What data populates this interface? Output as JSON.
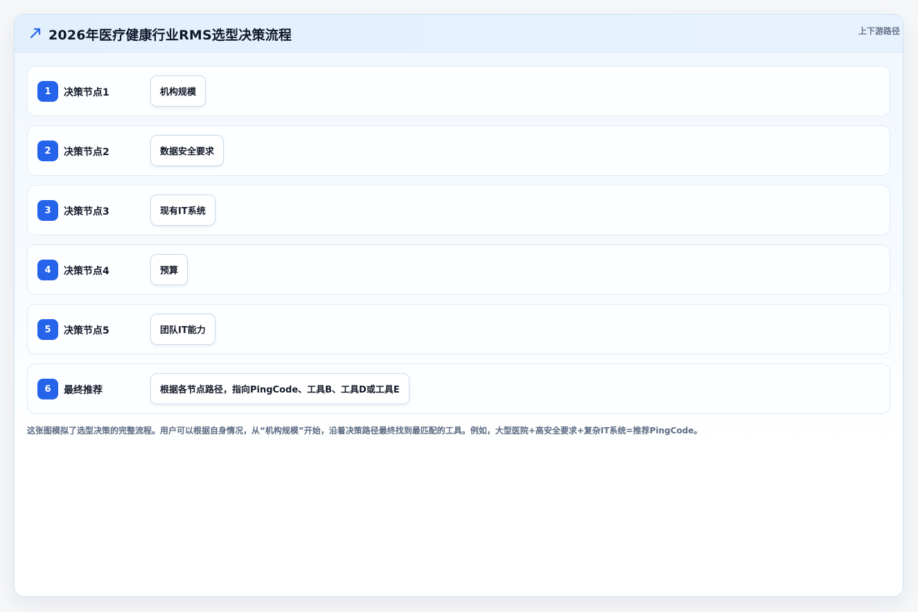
{
  "header": {
    "title": "2026年医疗健康行业RMS选型决策流程",
    "tag": "上下游路径",
    "icon": "trend-arrow-icon",
    "accent": "#2563eb"
  },
  "steps": [
    {
      "number": "1",
      "label": "决策节点1",
      "value": "机构规模"
    },
    {
      "number": "2",
      "label": "决策节点2",
      "value": "数据安全要求"
    },
    {
      "number": "3",
      "label": "决策节点3",
      "value": "现有IT系统"
    },
    {
      "number": "4",
      "label": "决策节点4",
      "value": "预算"
    },
    {
      "number": "5",
      "label": "决策节点5",
      "value": "团队IT能力"
    },
    {
      "number": "6",
      "label": "最终推荐",
      "value": "根据各节点路径，指向PingCode、工具B、工具D或工具E"
    }
  ],
  "note": "这张图模拟了选型决策的完整流程。用户可以根据自身情况，从“机构规模”开始，沿着决策路径最终找到最匹配的工具。例如，大型医院+高安全要求+复杂IT系统=推荐PingCode。"
}
